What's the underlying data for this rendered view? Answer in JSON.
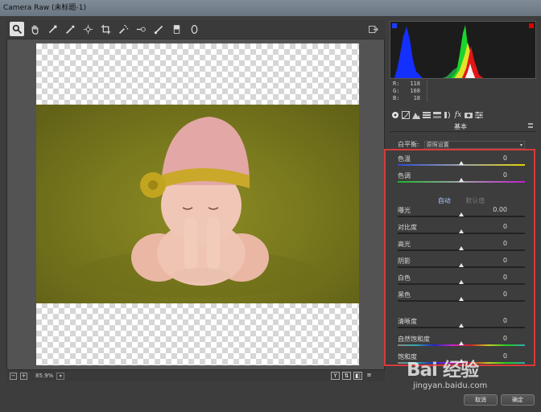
{
  "window": {
    "title": "Camera Raw (未标题-1)"
  },
  "toolbar": {
    "tools": [
      "zoom-icon",
      "hand-icon",
      "white-balance-icon",
      "color-sampler-icon",
      "targeted-adjustment-icon",
      "crop-icon",
      "spot-removal-icon",
      "red-eye-icon",
      "adjustment-brush-icon",
      "graduated-filter-icon",
      "radial-filter-icon"
    ],
    "active_tool": "zoom-icon"
  },
  "histogram": {
    "readout": {
      "r_label": "R:",
      "r_value": "118",
      "g_label": "G:",
      "g_value": "108",
      "b_label": "B:",
      "b_value": "18"
    }
  },
  "panel": {
    "title": "基本",
    "white_balance": {
      "label": "白平衡:",
      "selected": "原照设置"
    },
    "auto_label": "自动",
    "default_label": "默认值",
    "sliders": [
      {
        "label": "色温",
        "value": "0",
        "track": "temp",
        "position": 0.5
      },
      {
        "label": "色调",
        "value": "0",
        "track": "tint",
        "position": 0.5
      },
      {
        "label": "曝光",
        "value": "0.00",
        "track": "plain",
        "position": 0.5
      },
      {
        "label": "对比度",
        "value": "0",
        "track": "plain",
        "position": 0.5
      },
      {
        "label": "高光",
        "value": "0",
        "track": "plain",
        "position": 0.5
      },
      {
        "label": "阴影",
        "value": "0",
        "track": "plain",
        "position": 0.5
      },
      {
        "label": "白色",
        "value": "0",
        "track": "plain",
        "position": 0.5
      },
      {
        "label": "黑色",
        "value": "0",
        "track": "plain",
        "position": 0.5
      },
      {
        "label": "清晰度",
        "value": "0",
        "track": "plain",
        "position": 0.5
      },
      {
        "label": "自然饱和度",
        "value": "0",
        "track": "vib",
        "position": 0.5
      },
      {
        "label": "饱和度",
        "value": "0",
        "track": "sat",
        "position": 0.5
      }
    ]
  },
  "statusbar": {
    "zoom": "85.9%"
  },
  "buttons": {
    "cancel": "取消",
    "ok": "确定"
  },
  "watermark": {
    "logo": "Bai 经验",
    "sub": "jingyan.baidu.com"
  },
  "colors": {
    "highlight_outline": "#d83a3a",
    "accent_link": "#a9c7ff"
  }
}
